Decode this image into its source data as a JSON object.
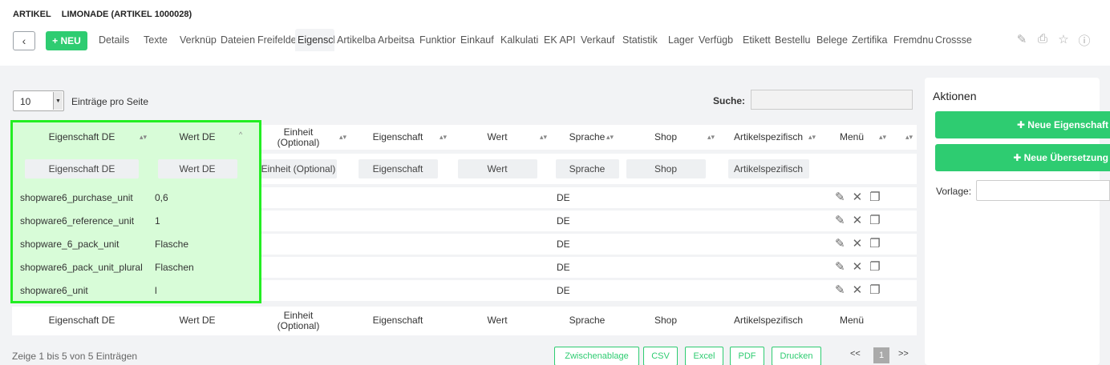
{
  "header": {
    "section": "ARTIKEL",
    "title": "LIMONADE (ARTIKEL 1000028)",
    "back_icon": "chevron-left-icon",
    "new_label": "+ NEU",
    "tabs": [
      "Details",
      "Texte",
      "Verknüp",
      "Dateien",
      "Freifelde",
      "Eigenscl",
      "Artikelba",
      "Arbeitsa",
      "Funktior",
      "Einkauf",
      "Kalkulati",
      "EK API",
      "Verkauf",
      "Statistik",
      "Lager",
      "Verfügb",
      "Etikett",
      "Bestellu",
      "Belege",
      "Zertifika",
      "Fremdnu",
      "Crossse"
    ],
    "active_tab": "Eigenscl",
    "tool_icons": [
      "pencil-icon",
      "print-icon",
      "star-icon",
      "help-icon"
    ]
  },
  "controls": {
    "per_page_value": "10",
    "per_page_label": "Einträge pro Seite",
    "search_label": "Suche:",
    "search_value": ""
  },
  "table": {
    "columns": [
      {
        "label": "Eigenschaft DE",
        "sort": "both"
      },
      {
        "label": "Wert DE",
        "sort": "asc"
      },
      {
        "label": "Einheit\n(Optional)",
        "sort": "both"
      },
      {
        "label": "Eigenschaft",
        "sort": "both"
      },
      {
        "label": "Wert",
        "sort": "both"
      },
      {
        "label": "Sprache",
        "sort": "both"
      },
      {
        "label": "Shop",
        "sort": "both"
      },
      {
        "label": "Artikelspezifisch",
        "sort": "both"
      },
      {
        "label": "Menü",
        "sort": "both"
      }
    ],
    "filters": [
      "Eigenschaft DE",
      "Wert DE",
      "Einheit (Optional)",
      "Eigenschaft",
      "Wert",
      "Sprache",
      "Shop",
      "Artikelspezifisch"
    ],
    "rows": [
      {
        "eigenschaft_de": "shopware6_purchase_unit",
        "wert_de": "0,6",
        "einheit": "",
        "eigenschaft": "",
        "wert": "",
        "sprache": "DE",
        "shop": "",
        "artikelspezifisch": ""
      },
      {
        "eigenschaft_de": "shopware6_reference_unit",
        "wert_de": "1",
        "einheit": "",
        "eigenschaft": "",
        "wert": "",
        "sprache": "DE",
        "shop": "",
        "artikelspezifisch": ""
      },
      {
        "eigenschaft_de": "shopware_6_pack_unit",
        "wert_de": "Flasche",
        "einheit": "",
        "eigenschaft": "",
        "wert": "",
        "sprache": "DE",
        "shop": "",
        "artikelspezifisch": ""
      },
      {
        "eigenschaft_de": "shopware6_pack_unit_plural",
        "wert_de": "Flaschen",
        "einheit": "",
        "eigenschaft": "",
        "wert": "",
        "sprache": "DE",
        "shop": "",
        "artikelspezifisch": ""
      },
      {
        "eigenschaft_de": "shopware6_unit",
        "wert_de": "l",
        "einheit": "",
        "eigenschaft": "",
        "wert": "",
        "sprache": "DE",
        "shop": "",
        "artikelspezifisch": ""
      }
    ],
    "row_actions": [
      "pencil-icon",
      "close-icon",
      "copy-icon"
    ],
    "footer_columns": [
      "Eigenschaft DE",
      "Wert DE",
      "Einheit\n(Optional)",
      "Eigenschaft",
      "Wert",
      "Sprache",
      "Shop",
      "Artikelspezifisch",
      "Menü"
    ],
    "highlight_color": "#22ee22"
  },
  "footer": {
    "info": "Zeige 1 bis 5 von 5 Einträgen",
    "export_buttons": [
      "Zwischenablage",
      "CSV",
      "Excel",
      "PDF",
      "Drucken"
    ],
    "pager_prev": "<<",
    "pager_current": "1",
    "pager_next": ">>"
  },
  "sidebar": {
    "title": "Aktionen",
    "buttons": [
      "✚ Neue Eigenschaft",
      "✚ Neue Übersetzung"
    ],
    "vorlage_label": "Vorlage:",
    "vorlage_value": ""
  },
  "colors": {
    "accent": "#2ecc71",
    "highlight_fill": "#d8fcd8"
  }
}
